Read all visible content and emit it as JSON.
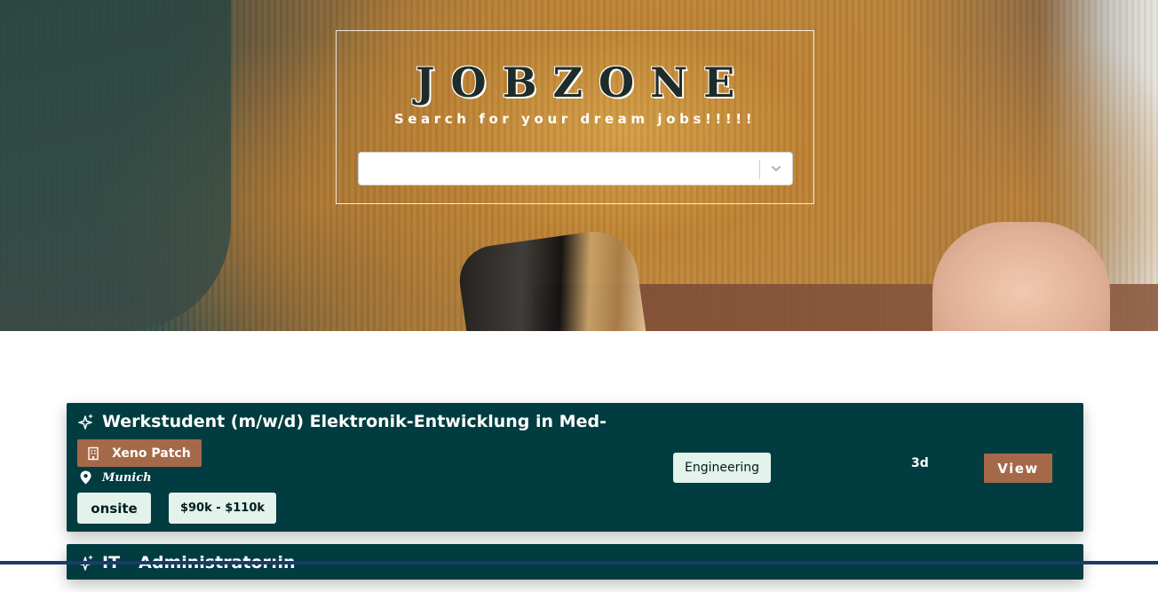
{
  "hero": {
    "brand": "JOBZONE",
    "tagline": "Search for your dream jobs!!!!!",
    "search_select": {
      "value": "",
      "placeholder": ""
    }
  },
  "jobs": [
    {
      "title": "Werkstudent (m/w/d) Elektronik-Entwicklung in Med-",
      "company": "Xeno Patch",
      "location": "Munich",
      "work_mode": "onsite",
      "salary": "$90k - $110k",
      "category": "Engineering",
      "age": "3d",
      "view_label": "View"
    },
    {
      "title": "IT - Administrator:in"
    }
  ],
  "icons": {
    "title": "sparkles-icon",
    "company": "building-icon",
    "location": "map-pin-icon",
    "select": "chevron-down-icon"
  },
  "colors": {
    "card_bg": "#003c40",
    "accent": "#a5694a",
    "chip_bg": "#e3f2ea"
  }
}
